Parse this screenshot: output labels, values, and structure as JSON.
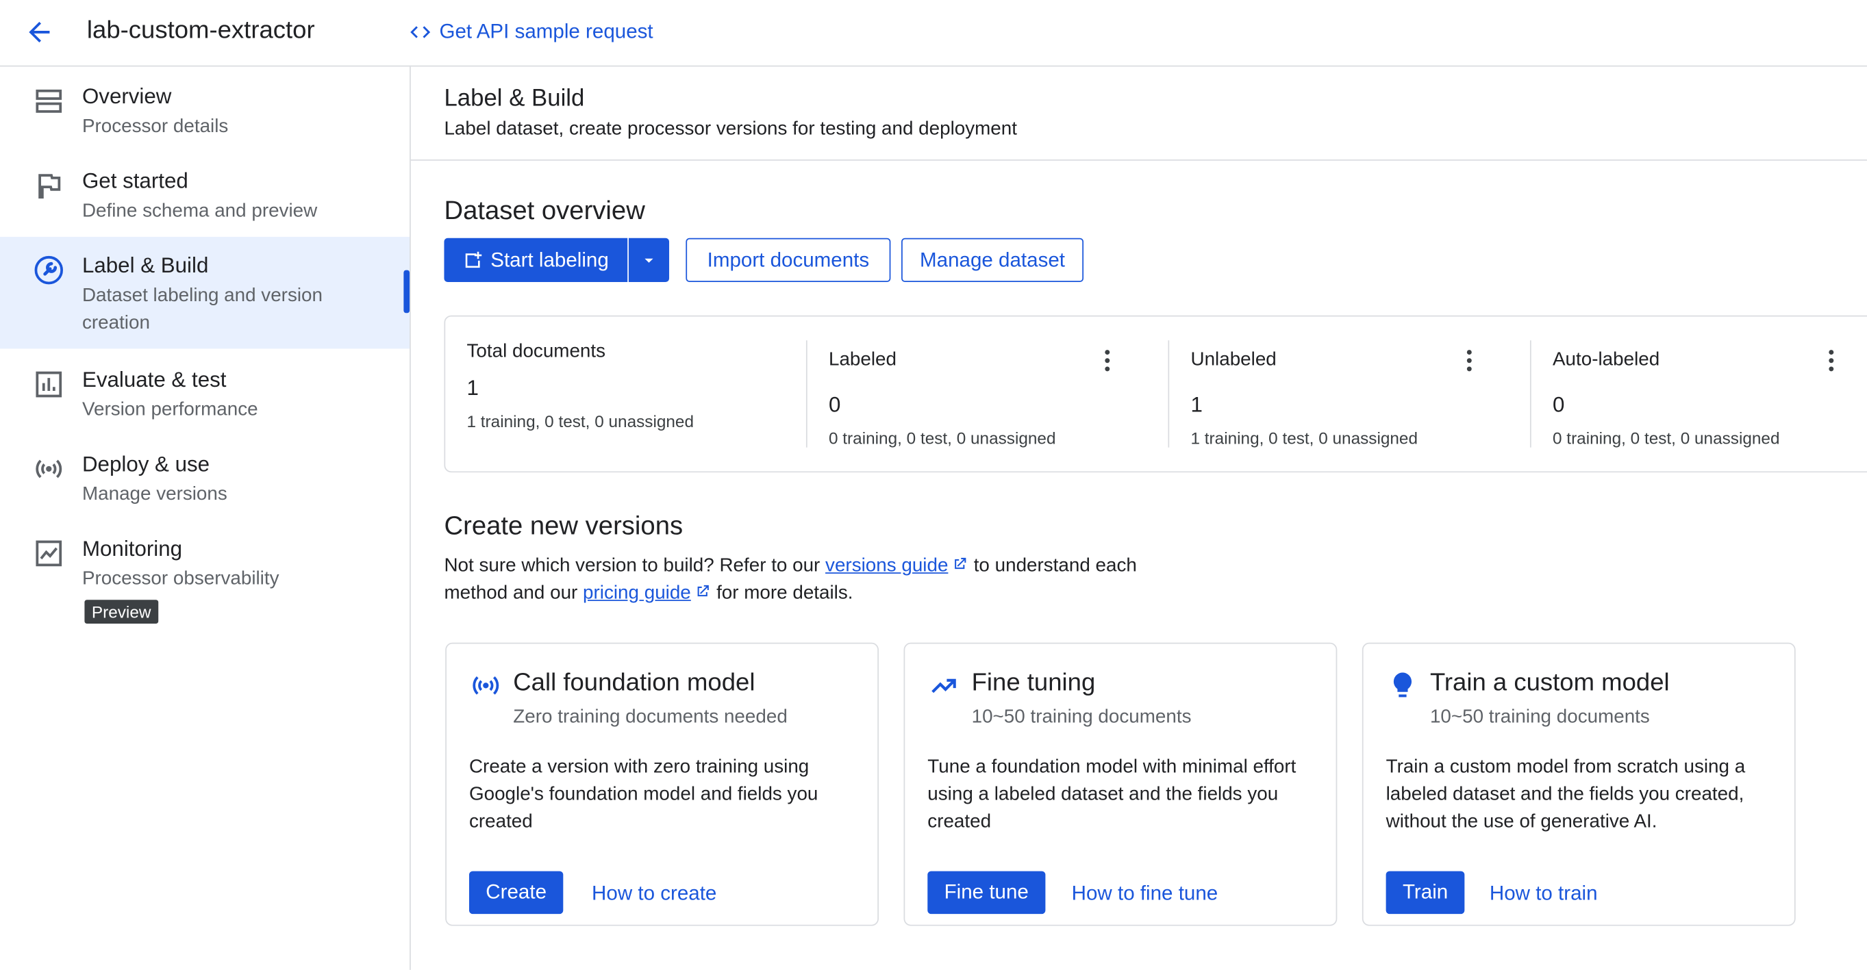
{
  "header": {
    "processor_name": "lab-custom-extractor",
    "api_link_label": "Get API sample request"
  },
  "sidebar": {
    "items": [
      {
        "title": "Overview",
        "subtitle": "Processor details",
        "icon": "list-icon"
      },
      {
        "title": "Get started",
        "subtitle": "Define schema and preview",
        "icon": "flag-icon"
      },
      {
        "title": "Label & Build",
        "subtitle": "Dataset labeling and version creation",
        "icon": "wrench-icon",
        "active": true
      },
      {
        "title": "Evaluate & test",
        "subtitle": "Version performance",
        "icon": "bar-chart-icon"
      },
      {
        "title": "Deploy & use",
        "subtitle": "Manage versions",
        "icon": "broadcast-icon"
      },
      {
        "title": "Monitoring",
        "subtitle": "Processor observability",
        "icon": "line-chart-icon",
        "badge": "Preview"
      }
    ]
  },
  "page": {
    "title": "Label & Build",
    "subtitle": "Label dataset, create processor versions for testing and deployment"
  },
  "dataset": {
    "heading": "Dataset overview",
    "start_labeling": "Start labeling",
    "import_documents": "Import documents",
    "manage_dataset": "Manage dataset",
    "stats": [
      {
        "label": "Total documents",
        "value": "1",
        "detail": "1 training, 0 test, 0 unassigned"
      },
      {
        "label": "Labeled",
        "value": "0",
        "detail": "0 training, 0 test, 0 unassigned"
      },
      {
        "label": "Unlabeled",
        "value": "1",
        "detail": "1 training, 0 test, 0 unassigned"
      },
      {
        "label": "Auto-labeled",
        "value": "0",
        "detail": "0 training, 0 test, 0 unassigned"
      }
    ]
  },
  "versions": {
    "heading": "Create new versions",
    "intro_1": "Not sure which version to build? Refer to our ",
    "versions_guide": "versions guide",
    "intro_2": " to understand each method and our ",
    "pricing_guide": "pricing guide",
    "intro_3": " for more details.",
    "cards": [
      {
        "title": "Call foundation model",
        "subtitle": "Zero training documents needed",
        "description": "Create a version with zero training using Google's foundation model and fields you created",
        "button": "Create",
        "link": "How to create",
        "icon": "broadcast-icon"
      },
      {
        "title": "Fine tuning",
        "subtitle": "10~50 training documents",
        "description": "Tune a foundation model with minimal effort using a labeled dataset and the fields you created",
        "button": "Fine tune",
        "link": "How to fine tune",
        "icon": "trending-up-icon"
      },
      {
        "title": "Train a custom model",
        "subtitle": "10~50 training documents",
        "description": "Train a custom model from scratch using a labeled dataset and the fields you created, without the use of generative AI.",
        "button": "Train",
        "link": "How to train",
        "icon": "lightbulb-icon"
      }
    ]
  },
  "colors": {
    "accent": "#1a56db",
    "active_bg": "#e8f0fe",
    "border": "#dadce0"
  }
}
